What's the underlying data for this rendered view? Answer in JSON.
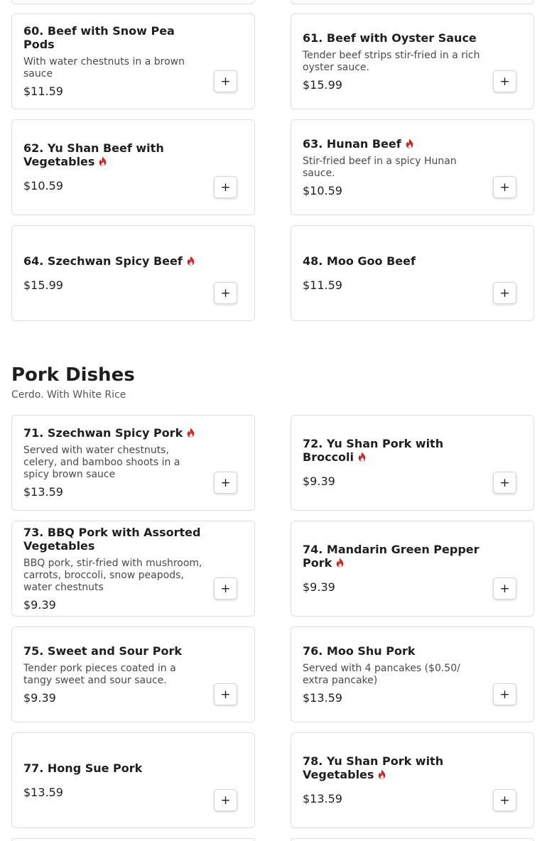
{
  "icons": {
    "spicy": "flame-icon",
    "add": "plus-icon"
  },
  "colors": {
    "spicy": "#c62828",
    "border": "#dedede",
    "text": "#1f1f1f"
  },
  "beef_items": [
    {
      "title": "60. Beef with Snow Pea Pods",
      "spicy": false,
      "desc": "With water chestnuts in a brown sauce",
      "price": "$11.59",
      "add_label": "+"
    },
    {
      "title": "61. Beef with Oyster Sauce",
      "spicy": false,
      "desc": "Tender beef strips stir-fried in a rich oyster sauce.",
      "price": "$15.99",
      "add_label": "+"
    },
    {
      "title": "62. Yu Shan Beef with Vegetables",
      "spicy": true,
      "price": "$10.59",
      "add_label": "+"
    },
    {
      "title": "63. Hunan Beef",
      "spicy": true,
      "desc": "Stir-fried beef in a spicy Hunan sauce.",
      "price": "$10.59",
      "add_label": "+"
    },
    {
      "title": "64. Szechwan Spicy Beef",
      "spicy": true,
      "price": "$15.99",
      "add_label": "+"
    },
    {
      "title": "48. Moo Goo Beef",
      "spicy": false,
      "price": "$11.59",
      "add_label": "+"
    }
  ],
  "pork_section": {
    "title": "Pork Dishes",
    "subtitle": "Cerdo. With White Rice",
    "items": [
      {
        "title": "71. Szechwan Spicy Pork",
        "spicy": true,
        "desc": "Served with water chestnuts, celery, and bamboo shoots in a spicy brown sauce",
        "price": "$13.59",
        "add_label": "+"
      },
      {
        "title": "72. Yu Shan Pork with Broccoli",
        "spicy": true,
        "price": "$9.39",
        "add_label": "+"
      },
      {
        "title": "73. BBQ Pork with Assorted Vegetables",
        "spicy": false,
        "desc": "BBQ pork, stir-fried with mushroom, carrots, broccoli, snow peapods, water chestnuts",
        "price": "$9.39",
        "add_label": "+"
      },
      {
        "title": "74. Mandarin Green Pepper Pork",
        "spicy": true,
        "price": "$9.39",
        "add_label": "+"
      },
      {
        "title": "75. Sweet and Sour Pork",
        "spicy": false,
        "desc": "Tender pork pieces coated in a tangy sweet and sour sauce.",
        "price": "$9.39",
        "add_label": "+"
      },
      {
        "title": "76. Moo Shu Pork",
        "spicy": false,
        "desc": "Served with 4 pancakes ($0.50/ extra pancake)",
        "price": "$13.59",
        "add_label": "+"
      },
      {
        "title": "77. Hong Sue Pork",
        "spicy": false,
        "price": "$13.59",
        "add_label": "+"
      },
      {
        "title": "78. Yu Shan Pork with Vegetables",
        "spicy": true,
        "price": "$13.59",
        "add_label": "+"
      }
    ]
  }
}
